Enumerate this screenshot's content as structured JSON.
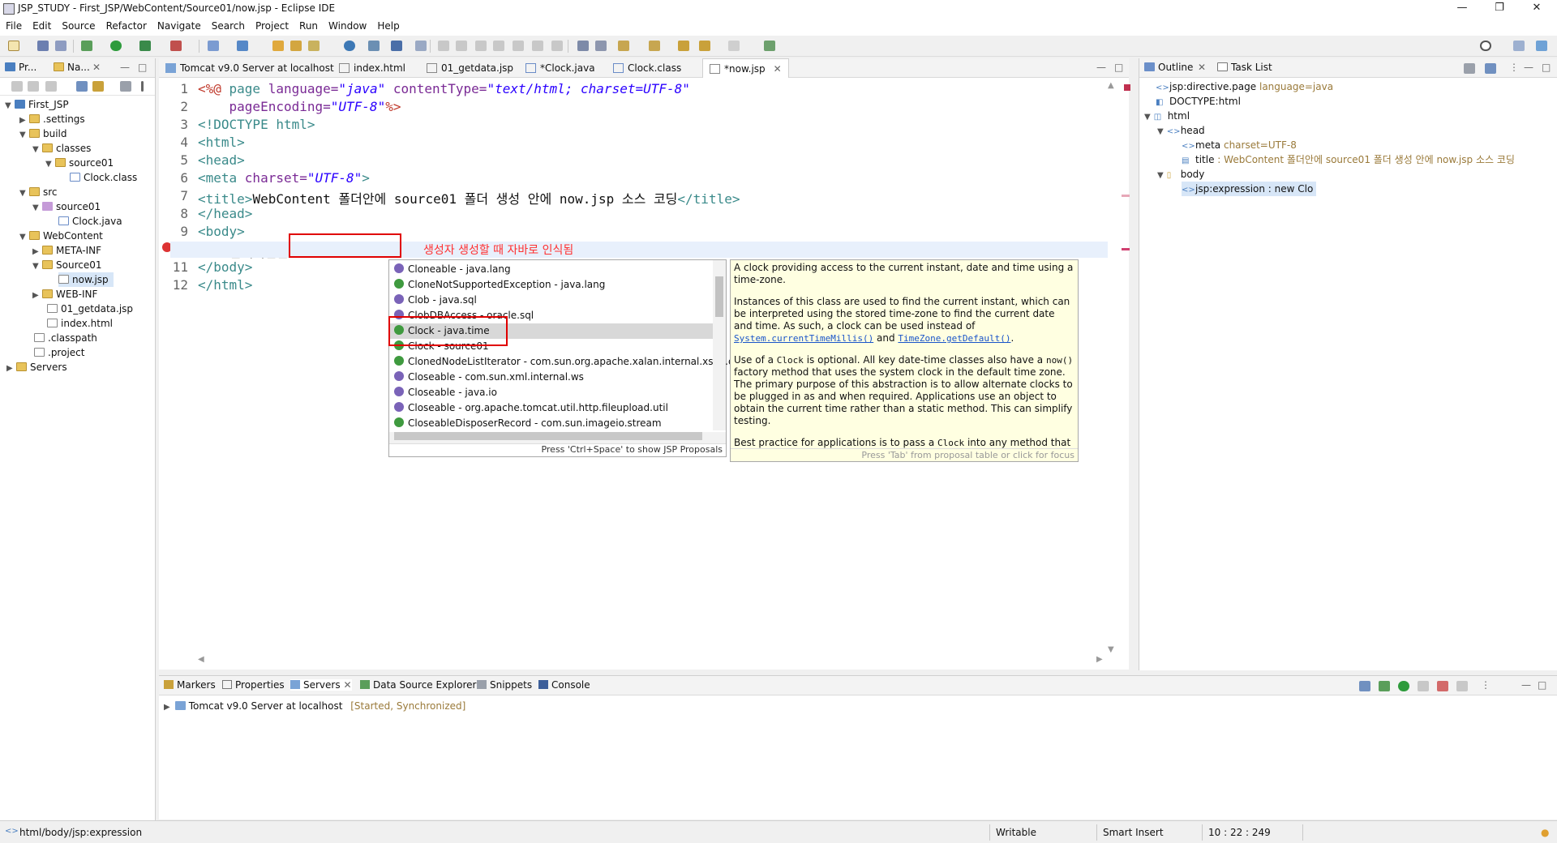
{
  "window": {
    "title": "JSP_STUDY - First_JSP/WebContent/Source01/now.jsp - Eclipse IDE",
    "minimize": "—",
    "maximize": "❐",
    "close": "✕"
  },
  "menu": [
    "File",
    "Edit",
    "Source",
    "Refactor",
    "Navigate",
    "Search",
    "Project",
    "Run",
    "Window",
    "Help"
  ],
  "left_panel": {
    "tabs": [
      "Pr...",
      "Na..."
    ],
    "tree": [
      {
        "label": "First_JSP",
        "icon": "project-icon"
      },
      {
        "label": ".settings",
        "icon": "folder-icon"
      },
      {
        "label": "build",
        "icon": "folder-icon"
      },
      {
        "label": "classes",
        "icon": "folder-icon"
      },
      {
        "label": "source01",
        "icon": "folder-icon"
      },
      {
        "label": "Clock.class",
        "icon": "class-file-icon"
      },
      {
        "label": "src",
        "icon": "folder-icon"
      },
      {
        "label": "source01",
        "icon": "package-icon"
      },
      {
        "label": "Clock.java",
        "icon": "java-file-icon"
      },
      {
        "label": "WebContent",
        "icon": "folder-icon"
      },
      {
        "label": "META-INF",
        "icon": "folder-icon"
      },
      {
        "label": "Source01",
        "icon": "folder-icon"
      },
      {
        "label": "now.jsp",
        "icon": "jsp-file-icon"
      },
      {
        "label": "WEB-INF",
        "icon": "folder-icon"
      },
      {
        "label": "01_getdata.jsp",
        "icon": "jsp-file-icon"
      },
      {
        "label": "index.html",
        "icon": "html-file-icon"
      },
      {
        "label": ".classpath",
        "icon": "xml-file-icon"
      },
      {
        "label": ".project",
        "icon": "xml-file-icon"
      },
      {
        "label": "Servers",
        "icon": "folder-icon"
      }
    ]
  },
  "editor": {
    "tabs": [
      {
        "label": "Tomcat v9.0 Server at localhost"
      },
      {
        "label": "index.html"
      },
      {
        "label": "01_getdata.jsp"
      },
      {
        "label": "*Clock.java"
      },
      {
        "label": "Clock.class"
      },
      {
        "label": "*now.jsp",
        "active": true
      }
    ],
    "line_numbers": [
      "1",
      "2",
      "3",
      "4",
      "5",
      "6",
      "7",
      "8",
      "9",
      "10",
      "11",
      "12"
    ],
    "lines": [
      [
        {
          "t": "<%@ ",
          "c": "jsp"
        },
        {
          "t": "page ",
          "c": "tag"
        },
        {
          "t": "language=",
          "c": "attr"
        },
        {
          "t": "\"java\"",
          "c": "str"
        },
        {
          "t": " contentType=",
          "c": "attr"
        },
        {
          "t": "\"text/html; charset=UTF-8\"",
          "c": "str"
        }
      ],
      [
        {
          "t": "    pageEncoding=",
          "c": "attr"
        },
        {
          "t": "\"UTF-8\"",
          "c": "str"
        },
        {
          "t": "%>",
          "c": "jsp"
        }
      ],
      [
        {
          "t": "<!DOCTYPE html>",
          "c": "tag"
        }
      ],
      [
        {
          "t": "<html>",
          "c": "tag"
        }
      ],
      [
        {
          "t": "<head>",
          "c": "tag"
        }
      ],
      [
        {
          "t": "<meta ",
          "c": "tag"
        },
        {
          "t": "charset=",
          "c": "attr"
        },
        {
          "t": "\"UTF-8\"",
          "c": "str"
        },
        {
          "t": ">",
          "c": "tag"
        }
      ],
      [
        {
          "t": "<title>",
          "c": "tag"
        },
        {
          "t": "WebContent 폴더안에 source01 폴더 생성 안에 now.jsp 소스 코딩",
          "c": ""
        },
        {
          "t": "</title>",
          "c": "tag"
        }
      ],
      [
        {
          "t": "</head>",
          "c": "tag"
        }
      ],
      [
        {
          "t": "<body>",
          "c": "tag"
        }
      ],
      [
        {
          "t": "    현재시간은 ",
          "c": ""
        },
        {
          "t": "<%= ",
          "c": "jsp"
        },
        {
          "t": "new ",
          "c": "kw"
        },
        {
          "t": "Clo",
          "c": ""
        },
        {
          "t": "%>",
          "c": "jsp"
        }
      ],
      [
        {
          "t": "</body>",
          "c": "tag"
        }
      ],
      [
        {
          "t": "</html>",
          "c": "tag"
        }
      ]
    ],
    "annotation": "생성자 생성할 때 자바로 인식됨"
  },
  "content_assist": {
    "proposals": [
      {
        "label": "Cloneable - java.lang",
        "kind": "interface"
      },
      {
        "label": "CloneNotSupportedException - java.lang",
        "kind": "class"
      },
      {
        "label": "Clob - java.sql",
        "kind": "interface"
      },
      {
        "label": "ClobDBAccess - oracle.sql",
        "kind": "interface"
      },
      {
        "label": "Clock - java.time",
        "kind": "class",
        "selected": true
      },
      {
        "label": "Clock - source01",
        "kind": "class"
      },
      {
        "label": "ClonedNodeListIterator - com.sun.org.apache.xalan.internal.xsltc.dom",
        "kind": "class"
      },
      {
        "label": "Closeable - com.sun.xml.internal.ws",
        "kind": "interface"
      },
      {
        "label": "Closeable - java.io",
        "kind": "interface"
      },
      {
        "label": "Closeable - org.apache.tomcat.util.http.fileupload.util",
        "kind": "interface"
      },
      {
        "label": "CloseableDisposerRecord - com.sun.imageio.stream",
        "kind": "class"
      }
    ],
    "footer": "Press 'Ctrl+Space' to show JSP Proposals"
  },
  "doc_popup": {
    "p1": "A clock providing access to the current instant, date and time using a time-zone.",
    "p2a": "Instances of this class are used to find the current instant, which can be interpreted using the stored time-zone to find the current date and time. As such, a clock can be used instead of ",
    "p2link1": "System.currentTimeMillis()",
    "p2b": " and ",
    "p2link2": "TimeZone.getDefault()",
    "p2c": ".",
    "p3a": "Use of a ",
    "p3code1": "Clock",
    "p3b": " is optional. All key date-time classes also have a ",
    "p3code2": "now()",
    "p3c": " factory method that uses the system clock in the default time zone. The primary purpose of this abstraction is to allow alternate clocks to be plugged in as and when required. Applications use an object to obtain the current time rather than a static method. This can simplify testing.",
    "p4a": "Best practice for applications is to pass a ",
    "p4code": "Clock",
    "p4b": " into any method that",
    "footer": "Press 'Tab' from proposal table or click for focus"
  },
  "outline": {
    "tabs": [
      "Outline",
      "Task List"
    ],
    "items": [
      {
        "label": "jsp:directive.page",
        "sub": "language=java"
      },
      {
        "label": "DOCTYPE:html",
        "sub": ""
      },
      {
        "label": "html",
        "sub": ""
      },
      {
        "label": "head",
        "sub": ""
      },
      {
        "label": "meta",
        "sub": "charset=UTF-8"
      },
      {
        "label": "title",
        "sub": ": WebContent 폴더안에 source01 폴더 생성 안에 now.jsp 소스 코딩"
      },
      {
        "label": "body",
        "sub": ""
      },
      {
        "label": "jsp:expression : new Clo",
        "sub": ""
      }
    ]
  },
  "bottom": {
    "tabs": [
      "Markers",
      "Properties",
      "Servers",
      "Data Source Explorer",
      "Snippets",
      "Console"
    ],
    "server_name": "Tomcat v9.0 Server at localhost",
    "server_state": "[Started, Synchronized]"
  },
  "status": {
    "path": "html/body/jsp:expression",
    "writable": "Writable",
    "insert_mode": "Smart Insert",
    "position": "10 : 22 : 249"
  },
  "colors": {
    "accent": "#e00000",
    "selection": "#d7e6f7",
    "doc_bg": "#ffffe1"
  }
}
